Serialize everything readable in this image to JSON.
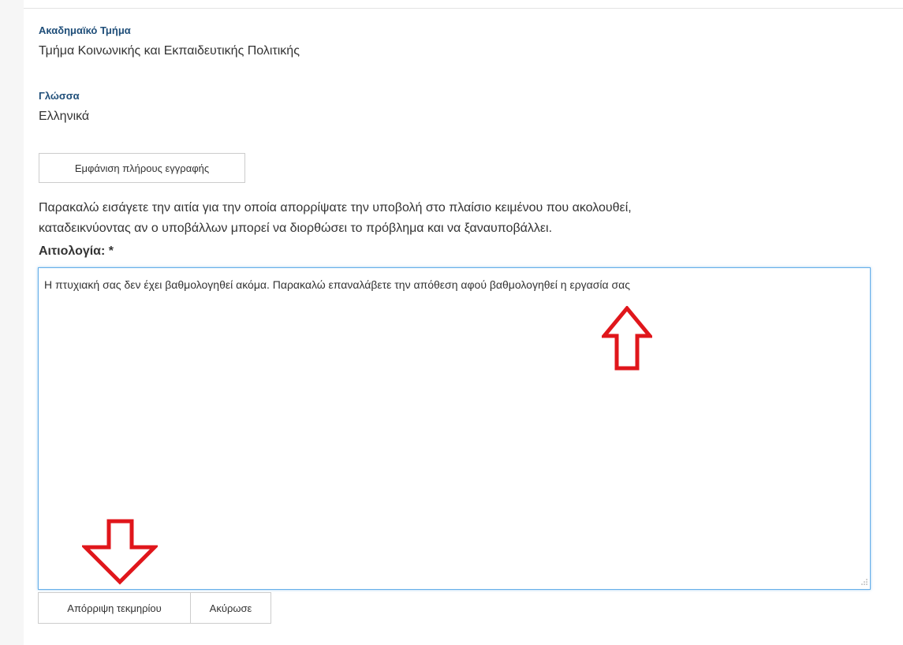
{
  "record": {
    "department_label": "Ακαδημαϊκό Τμήμα",
    "department_value": "Τμήμα Κοινωνικής και Εκπαιδευτικής Πολιτικής",
    "language_label": "Γλώσσα",
    "language_value": "Ελληνικά",
    "show_full_record_label": "Εμφάνιση πλήρους εγγραφής"
  },
  "rejection": {
    "instructions_line1": "Παρακαλώ εισάγετε την αιτία για την οποία απορρίψατε την υποβολή στο πλαίσιο κειμένου που ακολουθεί,",
    "instructions_line2": "καταδεικνύοντας αν ο υποβάλλων μπορεί να διορθώσει το πρόβλημα και να ξαναυποβάλλει.",
    "reason_label": "Αιτιολογία: *",
    "reason_value": "Η πτυχιακή σας δεν έχει βαθμολογηθεί ακόμα. Παρακαλώ επαναλάβετε την απόθεση αφού βαθμολογηθεί η εργασία σας",
    "reject_button_label": "Απόρριψη τεκμηρίου",
    "cancel_button_label": "Ακύρωσε"
  },
  "annotations": {
    "arrow_color": "#e0161b",
    "arrow_up_icon": "arrow-up-outline",
    "arrow_down_icon": "arrow-down-outline"
  },
  "colors": {
    "label_blue": "#1f4e79",
    "focus_border": "#66afe9",
    "button_border": "#cccccc"
  }
}
